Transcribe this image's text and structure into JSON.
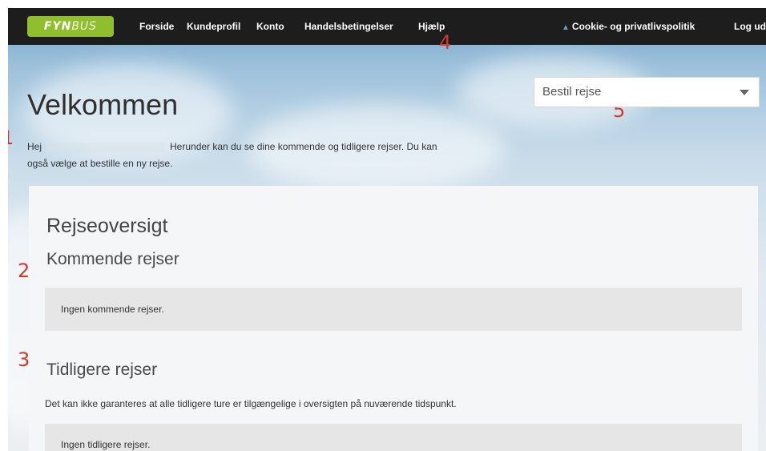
{
  "nav": {
    "logo_bold": "FYN",
    "logo_thin": "BUS",
    "links": [
      "Forside",
      "Kundeprofil",
      "Konto",
      "Handelsbetingelser",
      "Hjælp"
    ],
    "cookie_link": "Cookie- og privatlivspolitik",
    "logout": "Log ud"
  },
  "markers": [
    "1",
    "2",
    "3",
    "4",
    "5"
  ],
  "header": {
    "title": "Velkommen",
    "greeting": "Hej",
    "intro_text": "Herunder kan du se dine kommende og tidligere rejser. Du kan",
    "intro_text_2": "også vælge at bestille en ny rejse."
  },
  "order_select": {
    "value": "Bestil rejse"
  },
  "overview": {
    "title": "Rejseoversigt",
    "upcoming": {
      "title": "Kommende rejser",
      "empty": "Ingen kommende rejser."
    },
    "past": {
      "title": "Tidligere rejser",
      "note": "Det kan ikke garanteres at alle tidligere ture er tilgængelige i oversigten på nuværende tidspunkt.",
      "empty": "Ingen tidligere rejser."
    }
  },
  "colors": {
    "navbar": "#1d1d1d",
    "logo_bg": "#8fbf2c",
    "marker": "#d0392b",
    "cookie_icon": "#4ea6d8"
  }
}
